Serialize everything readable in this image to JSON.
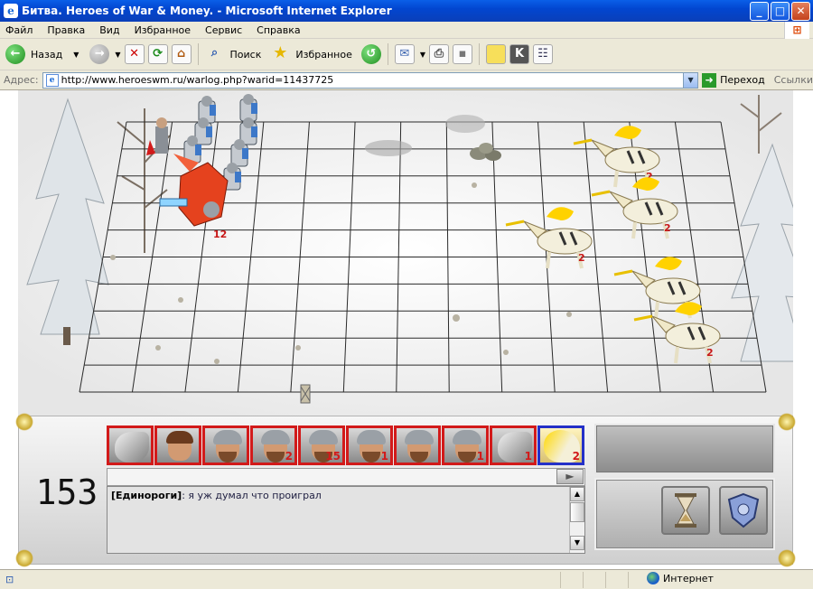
{
  "window": {
    "title": "Битва. Heroes of War & Money. - Microsoft Internet Explorer",
    "buttons": {
      "minimize": "_",
      "maximize": "□",
      "close": "✕"
    }
  },
  "menu": [
    "Файл",
    "Правка",
    "Вид",
    "Избранное",
    "Сервис",
    "Справка"
  ],
  "toolbar": {
    "back_label": "Назад",
    "search_label": "Поиск",
    "favorites_label": "Избранное"
  },
  "addressbar": {
    "label": "Адрес:",
    "url": "http://www.heroeswm.ru/warlog.php?warid=11437725",
    "go_label": "Переход",
    "links_label": "Ссылки"
  },
  "battle": {
    "grid": {
      "cols": 13,
      "rows": 10
    },
    "attacker_stacks": [
      {
        "unit": "griffin",
        "count": "12"
      }
    ],
    "defender_stacks": [
      {
        "unit": "unicorn",
        "count": "2"
      },
      {
        "unit": "unicorn",
        "count": "2"
      },
      {
        "unit": "unicorn",
        "count": "2"
      },
      {
        "unit": "unicorn",
        "count": "2"
      },
      {
        "unit": "unicorn",
        "count": "2"
      }
    ]
  },
  "queue": [
    {
      "unit": "griffin",
      "count": "",
      "side": "red"
    },
    {
      "unit": "hero",
      "count": "",
      "side": "red"
    },
    {
      "unit": "swordsman",
      "count": "",
      "side": "red"
    },
    {
      "unit": "archer",
      "count": "2",
      "side": "red"
    },
    {
      "unit": "swordsman",
      "count": "15",
      "side": "red"
    },
    {
      "unit": "swordsman",
      "count": "1",
      "side": "red"
    },
    {
      "unit": "swordsman",
      "count": "",
      "side": "red"
    },
    {
      "unit": "swordsman",
      "count": "1",
      "side": "red"
    },
    {
      "unit": "griffin",
      "count": "1",
      "side": "red"
    },
    {
      "unit": "unicorn",
      "count": "2",
      "side": "blue"
    }
  ],
  "turn_counter": "153",
  "chat": {
    "send_icon": "►",
    "messages": [
      {
        "nick": "[Единороги]",
        "text": ":  я уж думал что проиграл"
      }
    ]
  },
  "actions": {
    "wait_icon": "hourglass-icon",
    "defend_icon": "shield-icon"
  },
  "statusbar": {
    "zone_label": "Интернет"
  },
  "colors": {
    "attacker": "#d21a1a",
    "defender": "#2430c8",
    "unit_count": "#c81818"
  }
}
